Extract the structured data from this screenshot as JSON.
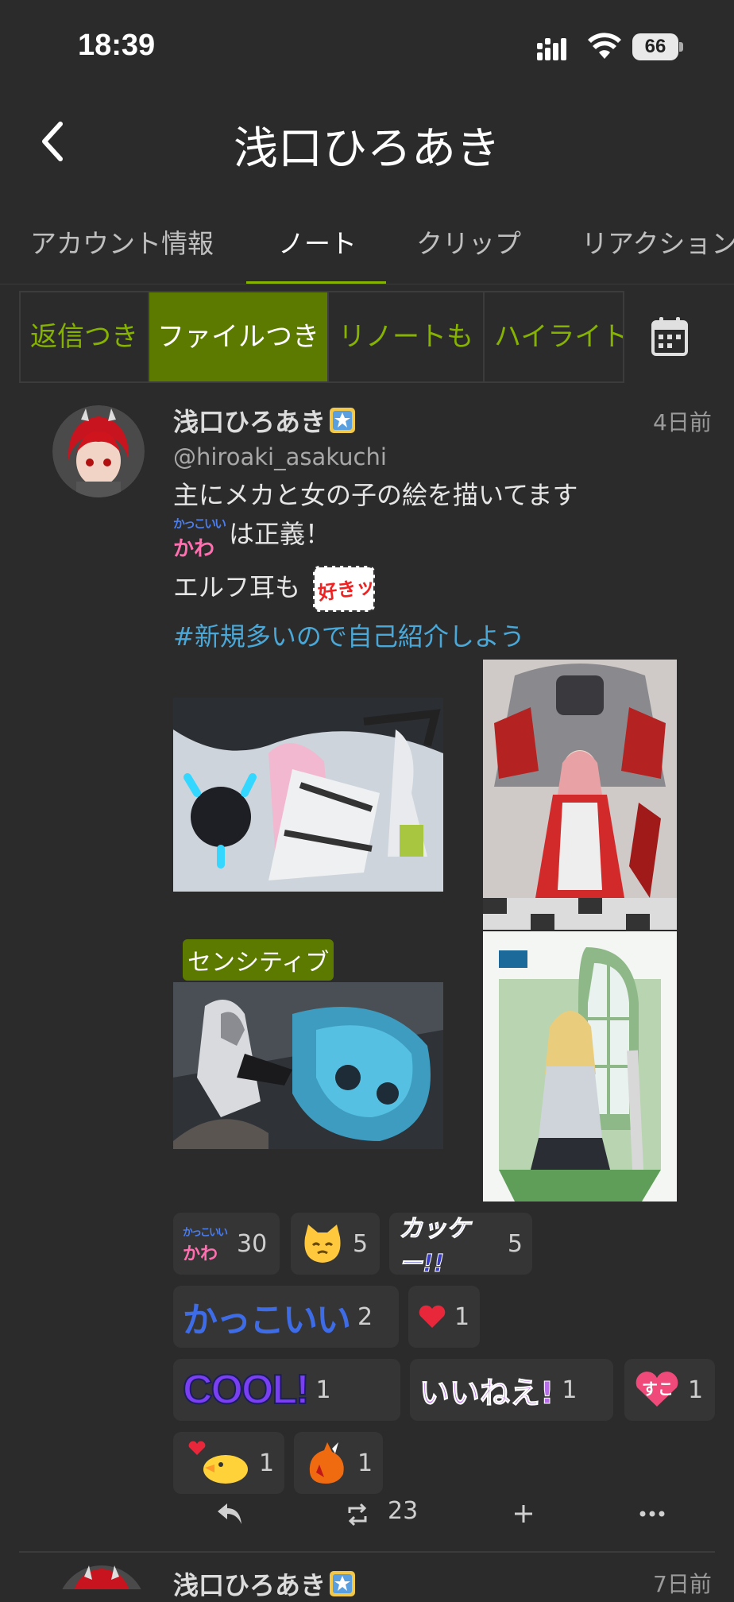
{
  "status": {
    "time": "18:39",
    "battery": "66"
  },
  "header": {
    "title": "浅口ひろあき"
  },
  "tabs": [
    "アカウント情報",
    "ノート",
    "クリップ",
    "リアクション"
  ],
  "filters": [
    "返信つき",
    "ファイルつき",
    "リノートも",
    "ハイライト"
  ],
  "note": {
    "name": "浅口ひろあき",
    "handle": "@hiroaki_asakuchi",
    "time": "4日前",
    "line1": "主にメカと女の子の絵を描いてます",
    "line2_emoji_top": "かっこいい",
    "line2_emoji_bottom": "かわ",
    "line2": "は正義！",
    "line3": "エルフ耳も",
    "line3_stamp": "好きッ",
    "hashtag": "#新規多いので自己紹介しよう",
    "sensitive_label": "センシティブ",
    "reactions": [
      {
        "emoji": "kakkoii-kawaii",
        "count": "30"
      },
      {
        "emoji": "cat-face",
        "count": "5"
      },
      {
        "emoji": "kakke-text",
        "label": "カッケー!!",
        "count": "5"
      },
      {
        "emoji": "kakkoii-text",
        "label": "かっこいい",
        "count": "2"
      },
      {
        "emoji": "heart",
        "count": "1"
      },
      {
        "emoji": "cool-text",
        "label": "COOL!",
        "count": "1"
      },
      {
        "emoji": "iine-text",
        "label": "いいねえ!",
        "count": "1"
      },
      {
        "emoji": "suko-heart",
        "label": "すこ",
        "count": "1"
      },
      {
        "emoji": "love-duck",
        "count": "1"
      },
      {
        "emoji": "fire-creature",
        "count": "1"
      }
    ],
    "renote_count": "23"
  },
  "next_note": {
    "name": "浅口ひろあき",
    "time": "7日前"
  }
}
